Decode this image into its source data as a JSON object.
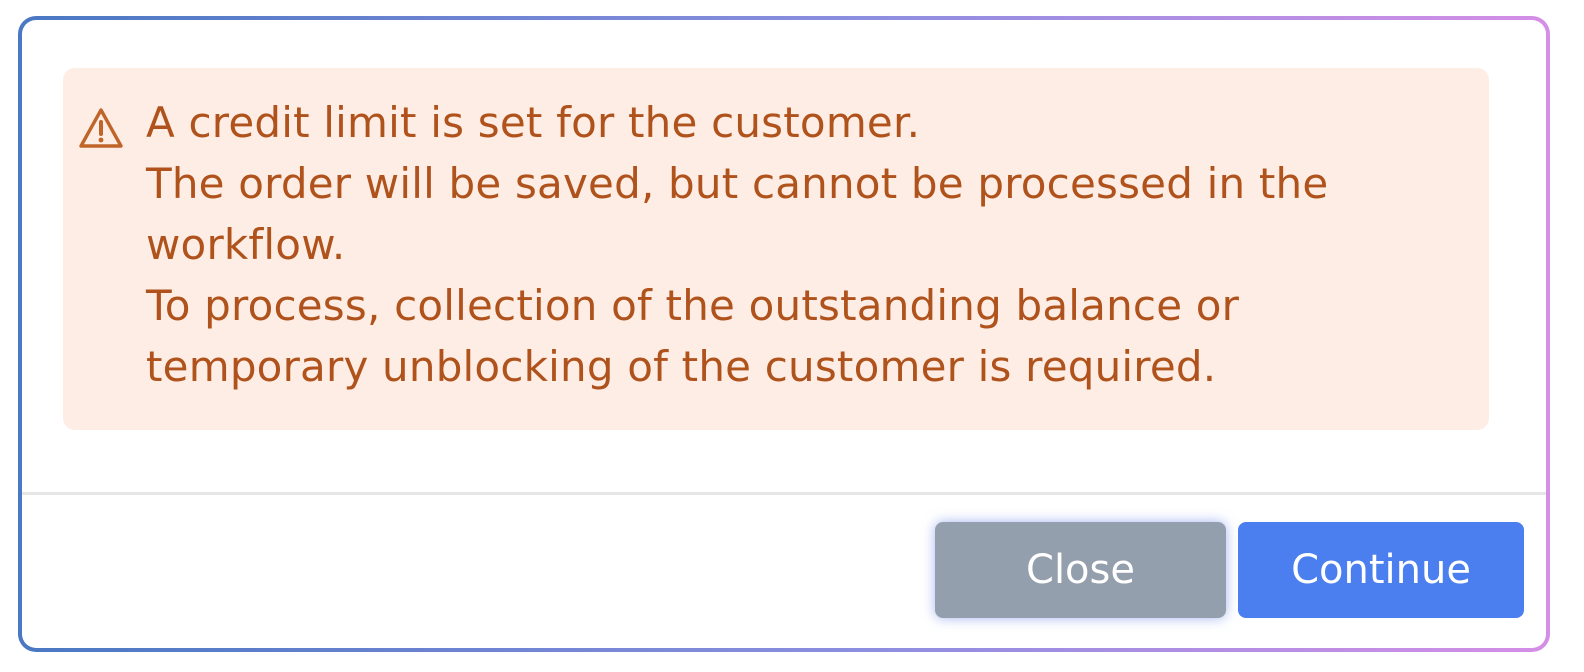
{
  "alert": {
    "icon": "warning-triangle-icon",
    "lines": [
      "A credit limit is set for the customer.",
      "The order will be saved, but cannot be processed in the",
      "workflow.",
      "To process, collection of the outstanding balance or",
      "temporary unblocking of the customer is required."
    ],
    "text_color": "#b0521c",
    "background_color": "#fdede4"
  },
  "footer": {
    "close_label": "Close",
    "continue_label": "Continue",
    "close_color": "#949fad",
    "continue_color": "#4b7ff0"
  }
}
